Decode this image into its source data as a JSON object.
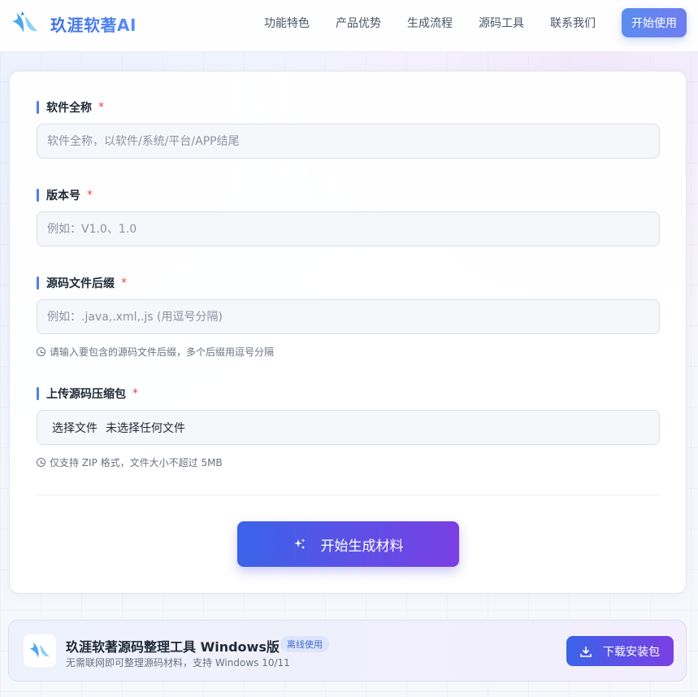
{
  "header": {
    "brand": "玖涯软著AI",
    "nav": [
      "功能特色",
      "产品优势",
      "生成流程",
      "源码工具",
      "联系我们"
    ],
    "cta": "开始使用"
  },
  "form": {
    "software_name": {
      "label": "软件全称",
      "required_mark": "*",
      "placeholder": "软件全称，以软件/系统/平台/APP结尾"
    },
    "version": {
      "label": "版本号",
      "required_mark": "*",
      "placeholder": "例如：V1.0、1.0"
    },
    "suffix": {
      "label": "源码文件后缀",
      "required_mark": "*",
      "placeholder": "例如：.java,.xml,.js (用逗号分隔)",
      "hint": "请输入要包含的源码文件后缀，多个后缀用逗号分隔"
    },
    "upload": {
      "label": "上传源码压缩包",
      "required_mark": "*",
      "choose_label": "选择文件",
      "status": "未选择任何文件",
      "hint": "仅支持 ZIP 格式，文件大小不超过 5MB"
    },
    "submit": "开始生成材料"
  },
  "download": {
    "title": "玖涯软著源码整理工具 Windows版",
    "badge": "离线使用",
    "subtitle": "无需联网即可整理源码材料，支持 Windows 10/11",
    "button": "下载安装包"
  },
  "colors": {
    "accent": "#4f7fe8",
    "gradient_start": "#3a63e8",
    "gradient_end": "#7b3fe4",
    "required": "#e5484d"
  }
}
